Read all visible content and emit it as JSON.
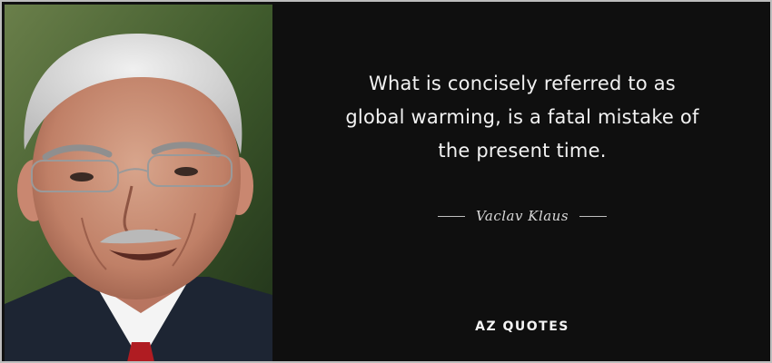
{
  "quote": {
    "lines": [
      "What is concisely referred to as",
      "global warming, is a fatal mistake of",
      "the present time."
    ]
  },
  "author": {
    "name": "Vaclav Klaus"
  },
  "brand": {
    "name": "AZ QUOTES"
  },
  "colors": {
    "background": "#0f0f0f",
    "text": "#f2f2f2",
    "frame_border": "#bdbdbd"
  },
  "photo": {
    "subject": "portrait-photo"
  }
}
